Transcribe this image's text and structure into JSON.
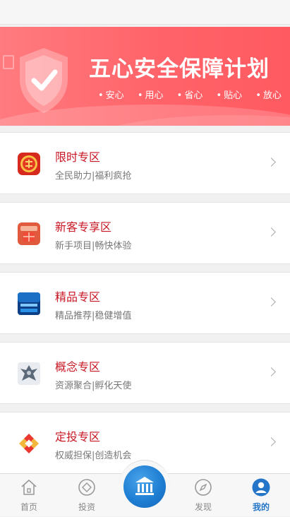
{
  "banner": {
    "title": "五心安全保障计划",
    "tags": [
      "安心",
      "用心",
      "省心",
      "贴心",
      "放心"
    ],
    "colors": {
      "start": "#ff7b7f",
      "end": "#ff5a61"
    },
    "shield_icon": "shield-check-icon"
  },
  "sections": [
    {
      "title": "限时专区",
      "subtitle": "全民助力|福利疯抢",
      "icon": "flash-sale-icon"
    },
    {
      "title": "新客专享区",
      "subtitle": "新手项目|畅快体验",
      "icon": "new-customer-icon"
    },
    {
      "title": "精品专区",
      "subtitle": "精品推荐|稳健增值",
      "icon": "premium-icon"
    },
    {
      "title": "概念专区",
      "subtitle": "资源聚合|孵化天使",
      "icon": "concept-icon"
    },
    {
      "title": "定投专区",
      "subtitle": "权威担保|创造机会",
      "icon": "fixed-investment-icon"
    }
  ],
  "colors": {
    "section_title": "#c81623",
    "active_tab": "#2575c9"
  },
  "tabbar": {
    "tabs": [
      {
        "label": "首页",
        "icon": "home-icon",
        "active": false
      },
      {
        "label": "投资",
        "icon": "invest-icon",
        "active": false
      },
      {
        "label": "",
        "icon": "bank-icon",
        "active": false
      },
      {
        "label": "发现",
        "icon": "compass-icon",
        "active": false
      },
      {
        "label": "我的",
        "icon": "user-icon",
        "active": true
      }
    ]
  }
}
